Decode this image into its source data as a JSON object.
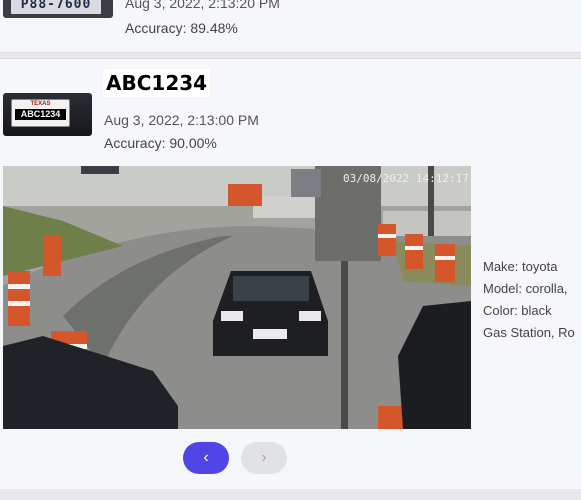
{
  "previous_card": {
    "plate_partial": "P88-7600",
    "date": "Aug 3, 2022, 2:13:20 PM",
    "accuracy": "Accuracy: 89.48%"
  },
  "current_card": {
    "plate": "ABC1234",
    "thumb_state": "TEXAS",
    "thumb_plate": "ABC1234",
    "date": "Aug 3, 2022, 2:13:00 PM",
    "accuracy": "Accuracy: 90.00%",
    "photo_timestamp": "03/08/2022 14:12:17",
    "details": {
      "make": "Make: toyota",
      "model": "Model: corolla,",
      "color": "Color: black",
      "location": "Gas Station, Ro"
    }
  },
  "pagination": {
    "prev_icon": "chevron-left-icon",
    "next_icon": "chevron-right-icon",
    "prev_glyph": "‹",
    "next_glyph": "›"
  },
  "colors": {
    "accent": "#4f46e5",
    "disabled": "#e1e2e6"
  }
}
